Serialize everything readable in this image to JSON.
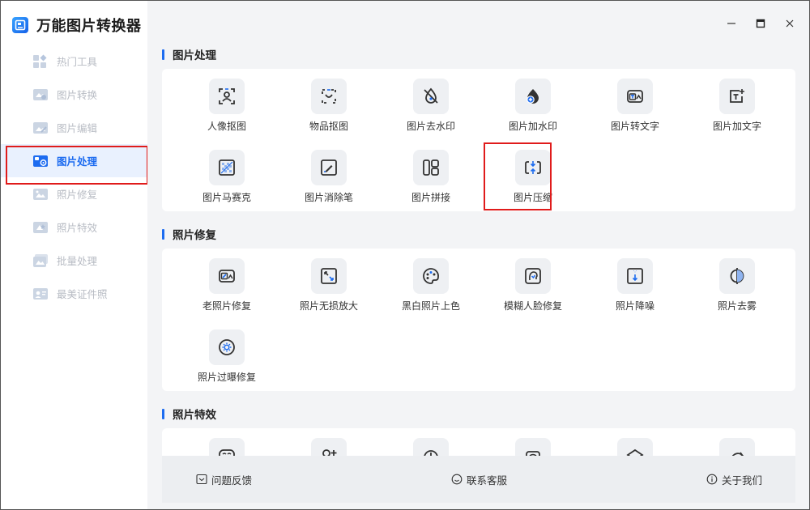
{
  "app": {
    "title": "万能图片转换器"
  },
  "sidebar": {
    "items": [
      {
        "label": "热门工具",
        "icon": "hot-tools-icon"
      },
      {
        "label": "图片转换",
        "icon": "image-convert-icon"
      },
      {
        "label": "图片编辑",
        "icon": "image-edit-icon"
      },
      {
        "label": "图片处理",
        "icon": "image-process-icon",
        "active": true
      },
      {
        "label": "照片修复",
        "icon": "photo-repair-icon"
      },
      {
        "label": "照片特效",
        "icon": "photo-effects-icon"
      },
      {
        "label": "批量处理",
        "icon": "batch-process-icon"
      },
      {
        "label": "最美证件照",
        "icon": "id-photo-icon"
      }
    ]
  },
  "window_controls": {
    "minimize": "—",
    "maximize": "□",
    "close": "×"
  },
  "sections": {
    "process": {
      "title": "图片处理",
      "tools": [
        {
          "label": "人像抠图",
          "icon": "portrait-cutout-icon"
        },
        {
          "label": "物品抠图",
          "icon": "object-cutout-icon"
        },
        {
          "label": "图片去水印",
          "icon": "remove-watermark-icon"
        },
        {
          "label": "图片加水印",
          "icon": "add-watermark-icon"
        },
        {
          "label": "图片转文字",
          "icon": "image-to-text-icon"
        },
        {
          "label": "图片加文字",
          "icon": "add-text-icon"
        },
        {
          "label": "图片马赛克",
          "icon": "mosaic-icon"
        },
        {
          "label": "图片消除笔",
          "icon": "eraser-pen-icon"
        },
        {
          "label": "图片拼接",
          "icon": "collage-icon"
        },
        {
          "label": "图片压缩",
          "icon": "compress-icon"
        }
      ]
    },
    "repair": {
      "title": "照片修复",
      "tools": [
        {
          "label": "老照片修复",
          "icon": "old-photo-repair-icon"
        },
        {
          "label": "照片无损放大",
          "icon": "lossless-upscale-icon"
        },
        {
          "label": "黑白照片上色",
          "icon": "colorize-icon"
        },
        {
          "label": "模糊人脸修复",
          "icon": "face-restore-icon"
        },
        {
          "label": "照片降噪",
          "icon": "denoise-icon"
        },
        {
          "label": "照片去雾",
          "icon": "dehaze-icon"
        },
        {
          "label": "照片过曝修复",
          "icon": "overexposure-fix-icon"
        }
      ]
    },
    "effects": {
      "title": "照片特效"
    }
  },
  "footer": {
    "feedback": "问题反馈",
    "support": "联系客服",
    "about": "关于我们"
  },
  "colors": {
    "accent": "#1d6cf0",
    "highlight": "#e01b1b"
  }
}
